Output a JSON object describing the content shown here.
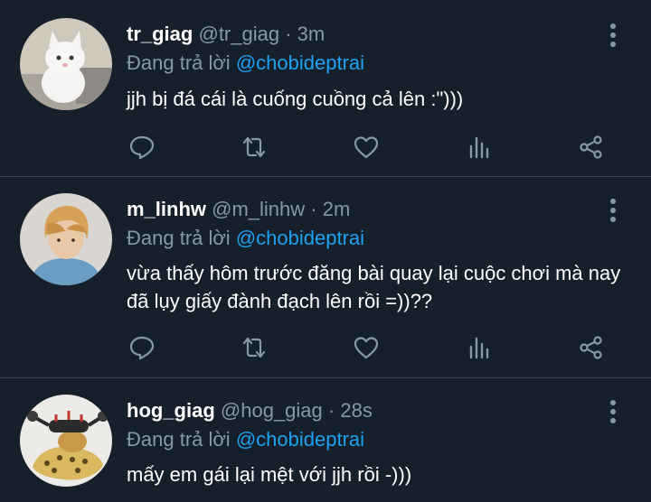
{
  "tweets": [
    {
      "display_name": "tr_giag",
      "handle": "@tr_giag",
      "separator": "·",
      "time": "3m",
      "reply_prefix": "Đang trả lời",
      "reply_to": "@chobideptrai",
      "text": "jjh bị đá cái là cuống cuồng cả lên :\")))"
    },
    {
      "display_name": "m_linhw",
      "handle": "@m_linhw",
      "separator": "·",
      "time": "2m",
      "reply_prefix": "Đang trả lời",
      "reply_to": "@chobideptrai",
      "text": "vừa thấy hôm trước đăng bài quay lại cuộc chơi mà nay đã lụy giấy đành đạch lên rồi =))??"
    },
    {
      "display_name": "hog_giag",
      "handle": "@hog_giag",
      "separator": "·",
      "time": "28s",
      "reply_prefix": "Đang trả lời",
      "reply_to": "@chobideptrai",
      "text": "mấy em gái lại mệt với jjh rồi -)))"
    }
  ],
  "icons": {
    "more": "more-vertical-icon",
    "reply": "comment-icon",
    "retweet": "retweet-icon",
    "like": "heart-icon",
    "stats": "analytics-icon",
    "share": "share-icon"
  },
  "colors": {
    "background": "#15202b",
    "divider": "#38444d",
    "primary_text": "#ffffff",
    "secondary_text": "#8899a6",
    "accent": "#1da1f2"
  }
}
